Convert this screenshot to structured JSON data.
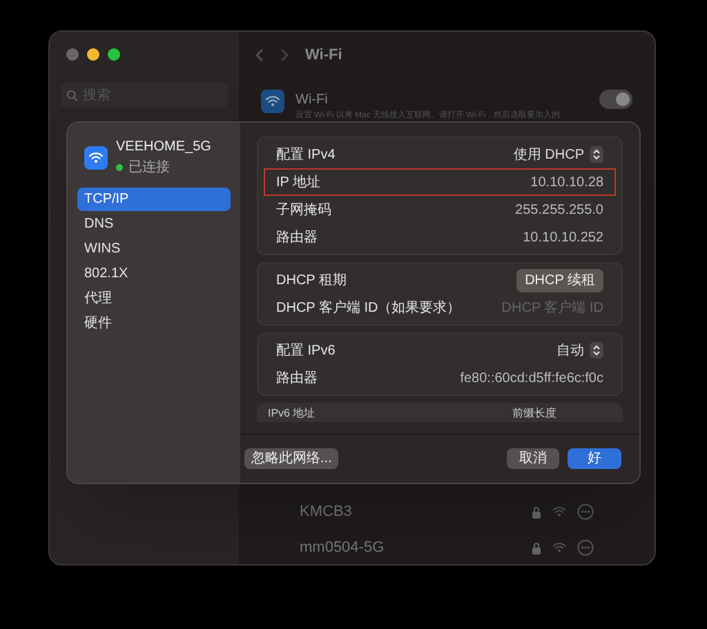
{
  "window": {
    "title": "Wi-Fi",
    "search": {
      "placeholder": "搜索"
    }
  },
  "wifi": {
    "title": "Wi-Fi",
    "on": true,
    "description": "设置 Wi-Fi 以将 Mac 无线接入互联网。请打开 Wi-Fi，然后选取要加入的"
  },
  "networks": [
    {
      "name": "KMCB3"
    },
    {
      "name": "mm0504-5G"
    }
  ],
  "sheet": {
    "network": {
      "name": "VEEHOME_5G",
      "status": "已连接"
    },
    "tabs": [
      {
        "label": "TCP/IP",
        "selected": true
      },
      {
        "label": "DNS",
        "selected": false
      },
      {
        "label": "WINS",
        "selected": false
      },
      {
        "label": "802.1X",
        "selected": false
      },
      {
        "label": "代理",
        "selected": false
      },
      {
        "label": "硬件",
        "selected": false
      }
    ],
    "groups": [
      {
        "rows": [
          {
            "kind": "select",
            "label": "配置 IPv4",
            "value": "使用 DHCP",
            "highlighted": false
          },
          {
            "kind": "text",
            "label": "IP 地址",
            "value": "10.10.10.28",
            "highlighted": true
          },
          {
            "kind": "text",
            "label": "子网掩码",
            "value": "255.255.255.0",
            "highlighted": false
          },
          {
            "kind": "text",
            "label": "路由器",
            "value": "10.10.10.252",
            "highlighted": false
          }
        ]
      },
      {
        "rows": [
          {
            "kind": "button",
            "label": "DHCP 租期",
            "value": "DHCP 续租",
            "highlighted": false
          },
          {
            "kind": "field",
            "label": "DHCP 客户端 ID（如果要求）",
            "placeholder": "DHCP 客户端 ID",
            "highlighted": false
          }
        ]
      },
      {
        "rows": [
          {
            "kind": "select",
            "label": "配置 IPv6",
            "value": "自动",
            "highlighted": false
          },
          {
            "kind": "text",
            "label": "路由器",
            "value": "fe80::60cd:d5ff:fe6c:f0c",
            "highlighted": false
          }
        ]
      }
    ],
    "ipv6_table": {
      "columns": [
        "IPv6 地址",
        "前缀长度"
      ]
    },
    "buttons": {
      "forget": "忽略此网络...",
      "cancel": "取消",
      "ok": "好"
    }
  }
}
